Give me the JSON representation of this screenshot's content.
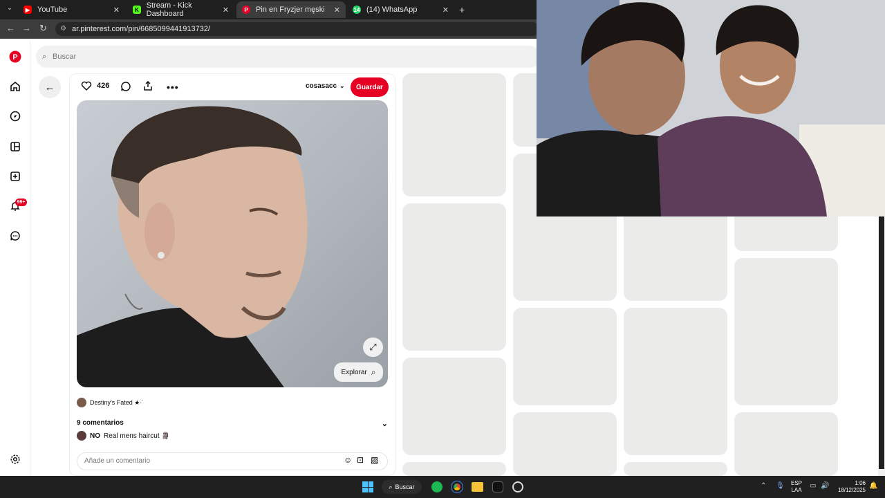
{
  "browser": {
    "tabs": [
      {
        "label": "YouTube",
        "favicon": "youtube-icon",
        "color": "#ff0000",
        "active": false
      },
      {
        "label": "Stream - Kick Dashboard",
        "favicon": "kick-icon",
        "color": "#53fc18",
        "active": false
      },
      {
        "label": "Pin en Fryzjer męski",
        "favicon": "pinterest-icon",
        "color": "#e60023",
        "active": true
      },
      {
        "label": "(14) WhatsApp",
        "favicon": "whatsapp-icon",
        "color": "#25d366",
        "active": false,
        "badge": "14"
      }
    ],
    "new_tab_label": "+",
    "url": "ar.pinterest.com/pin/6685099441913732/"
  },
  "pinterest": {
    "search_placeholder": "Buscar",
    "notifications_badge": "99+",
    "pin": {
      "likes": "426",
      "author": "cosasacc",
      "save_label": "Guardar",
      "explore_label": "Explorar",
      "uploader": "Destiny's Fated ★·˙",
      "comments_header": "9 comentarios",
      "comment_user": "NO",
      "comment_text": "Real mens haircut 🗿",
      "comment_placeholder": "Añade un comentario"
    }
  },
  "taskbar": {
    "search_label": "Buscar",
    "language": "ESP",
    "layout": "LAA",
    "time": "1:06",
    "date": "18/12/2025"
  },
  "colors": {
    "pinterest_red": "#e60023",
    "chrome_dark": "#1f1f1f",
    "skeleton": "#ebebea"
  }
}
